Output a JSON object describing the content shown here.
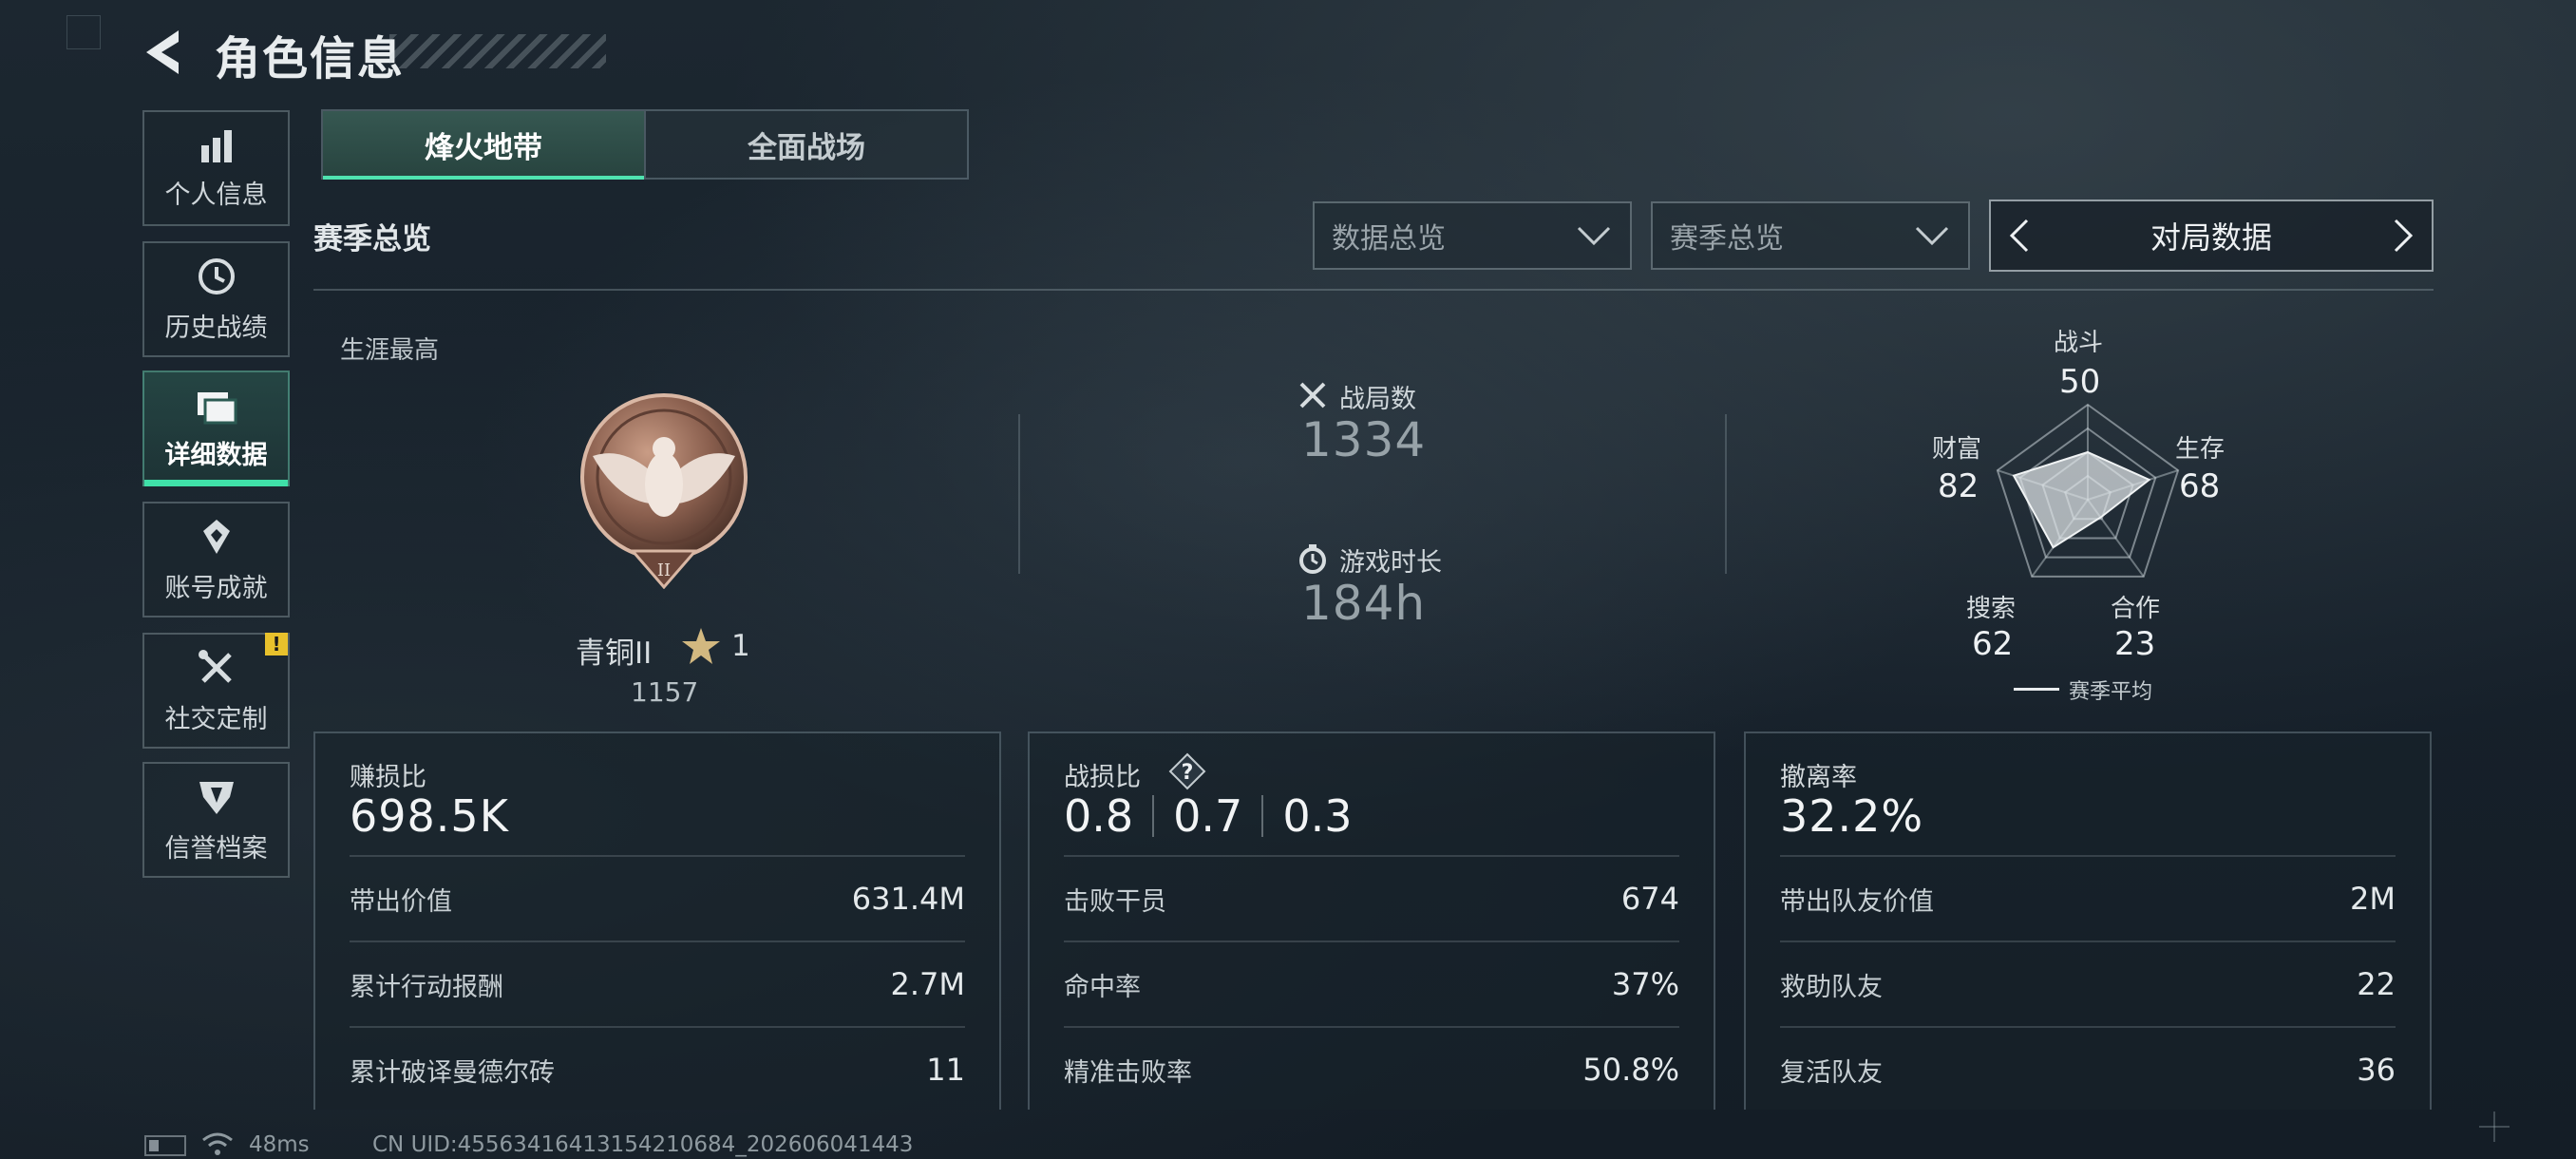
{
  "header": {
    "title": "角色信息",
    "back_icon": "back-arrow-icon"
  },
  "sidebar": {
    "items": [
      {
        "label": "个人信息",
        "icon": "bar-chart-icon",
        "active": false
      },
      {
        "label": "历史战绩",
        "icon": "history-clock-icon",
        "active": false
      },
      {
        "label": "详细数据",
        "icon": "folder-data-icon",
        "active": true
      },
      {
        "label": "账号成就",
        "icon": "achievement-icon",
        "active": false
      },
      {
        "label": "社交定制",
        "icon": "tools-icon",
        "active": false,
        "badge": "!"
      },
      {
        "label": "信誉档案",
        "icon": "credit-shield-icon",
        "active": false
      }
    ]
  },
  "tabs": [
    {
      "label": "烽火地带",
      "active": true
    },
    {
      "label": "全面战场",
      "active": false
    }
  ],
  "section": {
    "title": "赛季总览"
  },
  "filters": {
    "dropdown1": "数据总览",
    "dropdown2": "赛季总览",
    "switcher": "对局数据"
  },
  "career": {
    "label": "生涯最高",
    "rank_name": "青铜II",
    "rank_stars": "1",
    "rank_score": "1157"
  },
  "overview": {
    "matches_label": "战局数",
    "matches_value": "1334",
    "playtime_label": "游戏时长",
    "playtime_value": "184h"
  },
  "radar": {
    "labels": {
      "combat": "战斗",
      "survival": "生存",
      "teamwork": "合作",
      "search": "搜索",
      "wealth": "财富"
    },
    "values": {
      "combat": "50",
      "survival": "68",
      "teamwork": "23",
      "search": "62",
      "wealth": "82"
    },
    "legend": "赛季平均"
  },
  "cards": {
    "profit": {
      "title": "赚损比",
      "value": "698.5K",
      "rows": [
        {
          "k": "带出价值",
          "v": "631.4M"
        },
        {
          "k": "累计行动报酬",
          "v": "2.7M"
        },
        {
          "k": "累计破译曼德尔砖",
          "v": "11"
        }
      ]
    },
    "kd": {
      "title": "战损比",
      "help": "?",
      "values": [
        "0.8",
        "0.7",
        "0.3"
      ],
      "rows": [
        {
          "k": "击败干员",
          "v": "674"
        },
        {
          "k": "命中率",
          "v": "37%"
        },
        {
          "k": "精准击败率",
          "v": "50.8%"
        }
      ]
    },
    "extract": {
      "title": "撤离率",
      "value": "32.2%",
      "rows": [
        {
          "k": "带出队友价值",
          "v": "2M"
        },
        {
          "k": "救助队友",
          "v": "22"
        },
        {
          "k": "复活队友",
          "v": "36"
        }
      ]
    }
  },
  "footer": {
    "ping": "48ms",
    "uid": "CN UID:45563416413154210684_202606041443"
  },
  "colors": {
    "accent": "#3fe0a8",
    "warning": "#e8c12c"
  }
}
